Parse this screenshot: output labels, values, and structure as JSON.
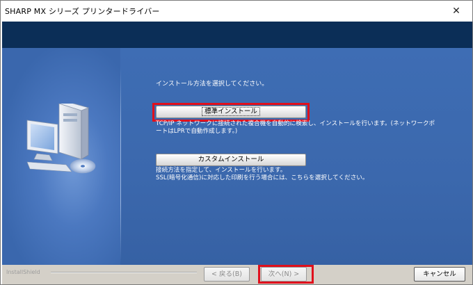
{
  "window": {
    "title": "SHARP MX シリーズ プリンタードライバー",
    "close_glyph": "✕"
  },
  "main": {
    "instruction": "インストール方法を選択してください。",
    "standard_button_label": "標準インストール",
    "standard_description_line1": "TCP/IP ネットワークに接続された複合機を自動的に検索し、インストールを行います。(ネットワークポ",
    "standard_description_line2": "ートはLPRで自動作成します。)",
    "custom_button_label": "カスタムインストール",
    "custom_description_line1": "接続方法を指定して、インストールを行います。",
    "custom_description_line2": "SSL(暗号化通信)に対応した印刷を行う場合には、こちらを選択してください。"
  },
  "footer": {
    "installshield": "InstallShield",
    "back_label": "< 戻る(B)",
    "next_label": "次へ(N) >",
    "cancel_label": "キャンセル"
  },
  "icons": {
    "computer": "computer-icon",
    "cd": "cd-icon"
  },
  "colors": {
    "header_band": "#0b2e57",
    "content_bg": "#3e6db4",
    "highlight": "#e0101c",
    "footer_bg": "#d4d0c8"
  }
}
